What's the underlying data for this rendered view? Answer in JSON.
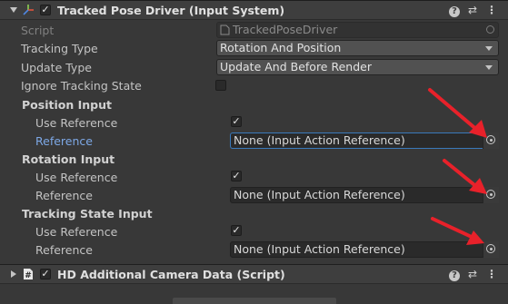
{
  "tracked_pose_driver": {
    "title": "Tracked Pose Driver (Input System)",
    "script_label": "Script",
    "script_value": "TrackedPoseDriver",
    "tracking_type_label": "Tracking Type",
    "tracking_type_value": "Rotation And Position",
    "update_type_label": "Update Type",
    "update_type_value": "Update And Before Render",
    "ignore_tracking_label": "Ignore Tracking State",
    "position_input": {
      "heading": "Position Input",
      "use_reference_label": "Use Reference",
      "reference_label": "Reference",
      "reference_value": "None (Input Action Reference)"
    },
    "rotation_input": {
      "heading": "Rotation Input",
      "use_reference_label": "Use Reference",
      "reference_label": "Reference",
      "reference_value": "None (Input Action Reference)"
    },
    "tracking_state_input": {
      "heading": "Tracking State Input",
      "use_reference_label": "Use Reference",
      "reference_label": "Reference",
      "reference_value": "None (Input Action Reference)"
    }
  },
  "hd_camera": {
    "title": "HD Additional Camera Data (Script)"
  },
  "glyphs": {
    "check": "✓",
    "help": "?",
    "presets": "⇄",
    "menu": "⋮"
  },
  "colors": {
    "background": "#383838",
    "header": "#3e3e3e",
    "focus_border": "#3a79bb",
    "active_label": "#7da8e6",
    "annotation_arrow": "#e8212a"
  }
}
